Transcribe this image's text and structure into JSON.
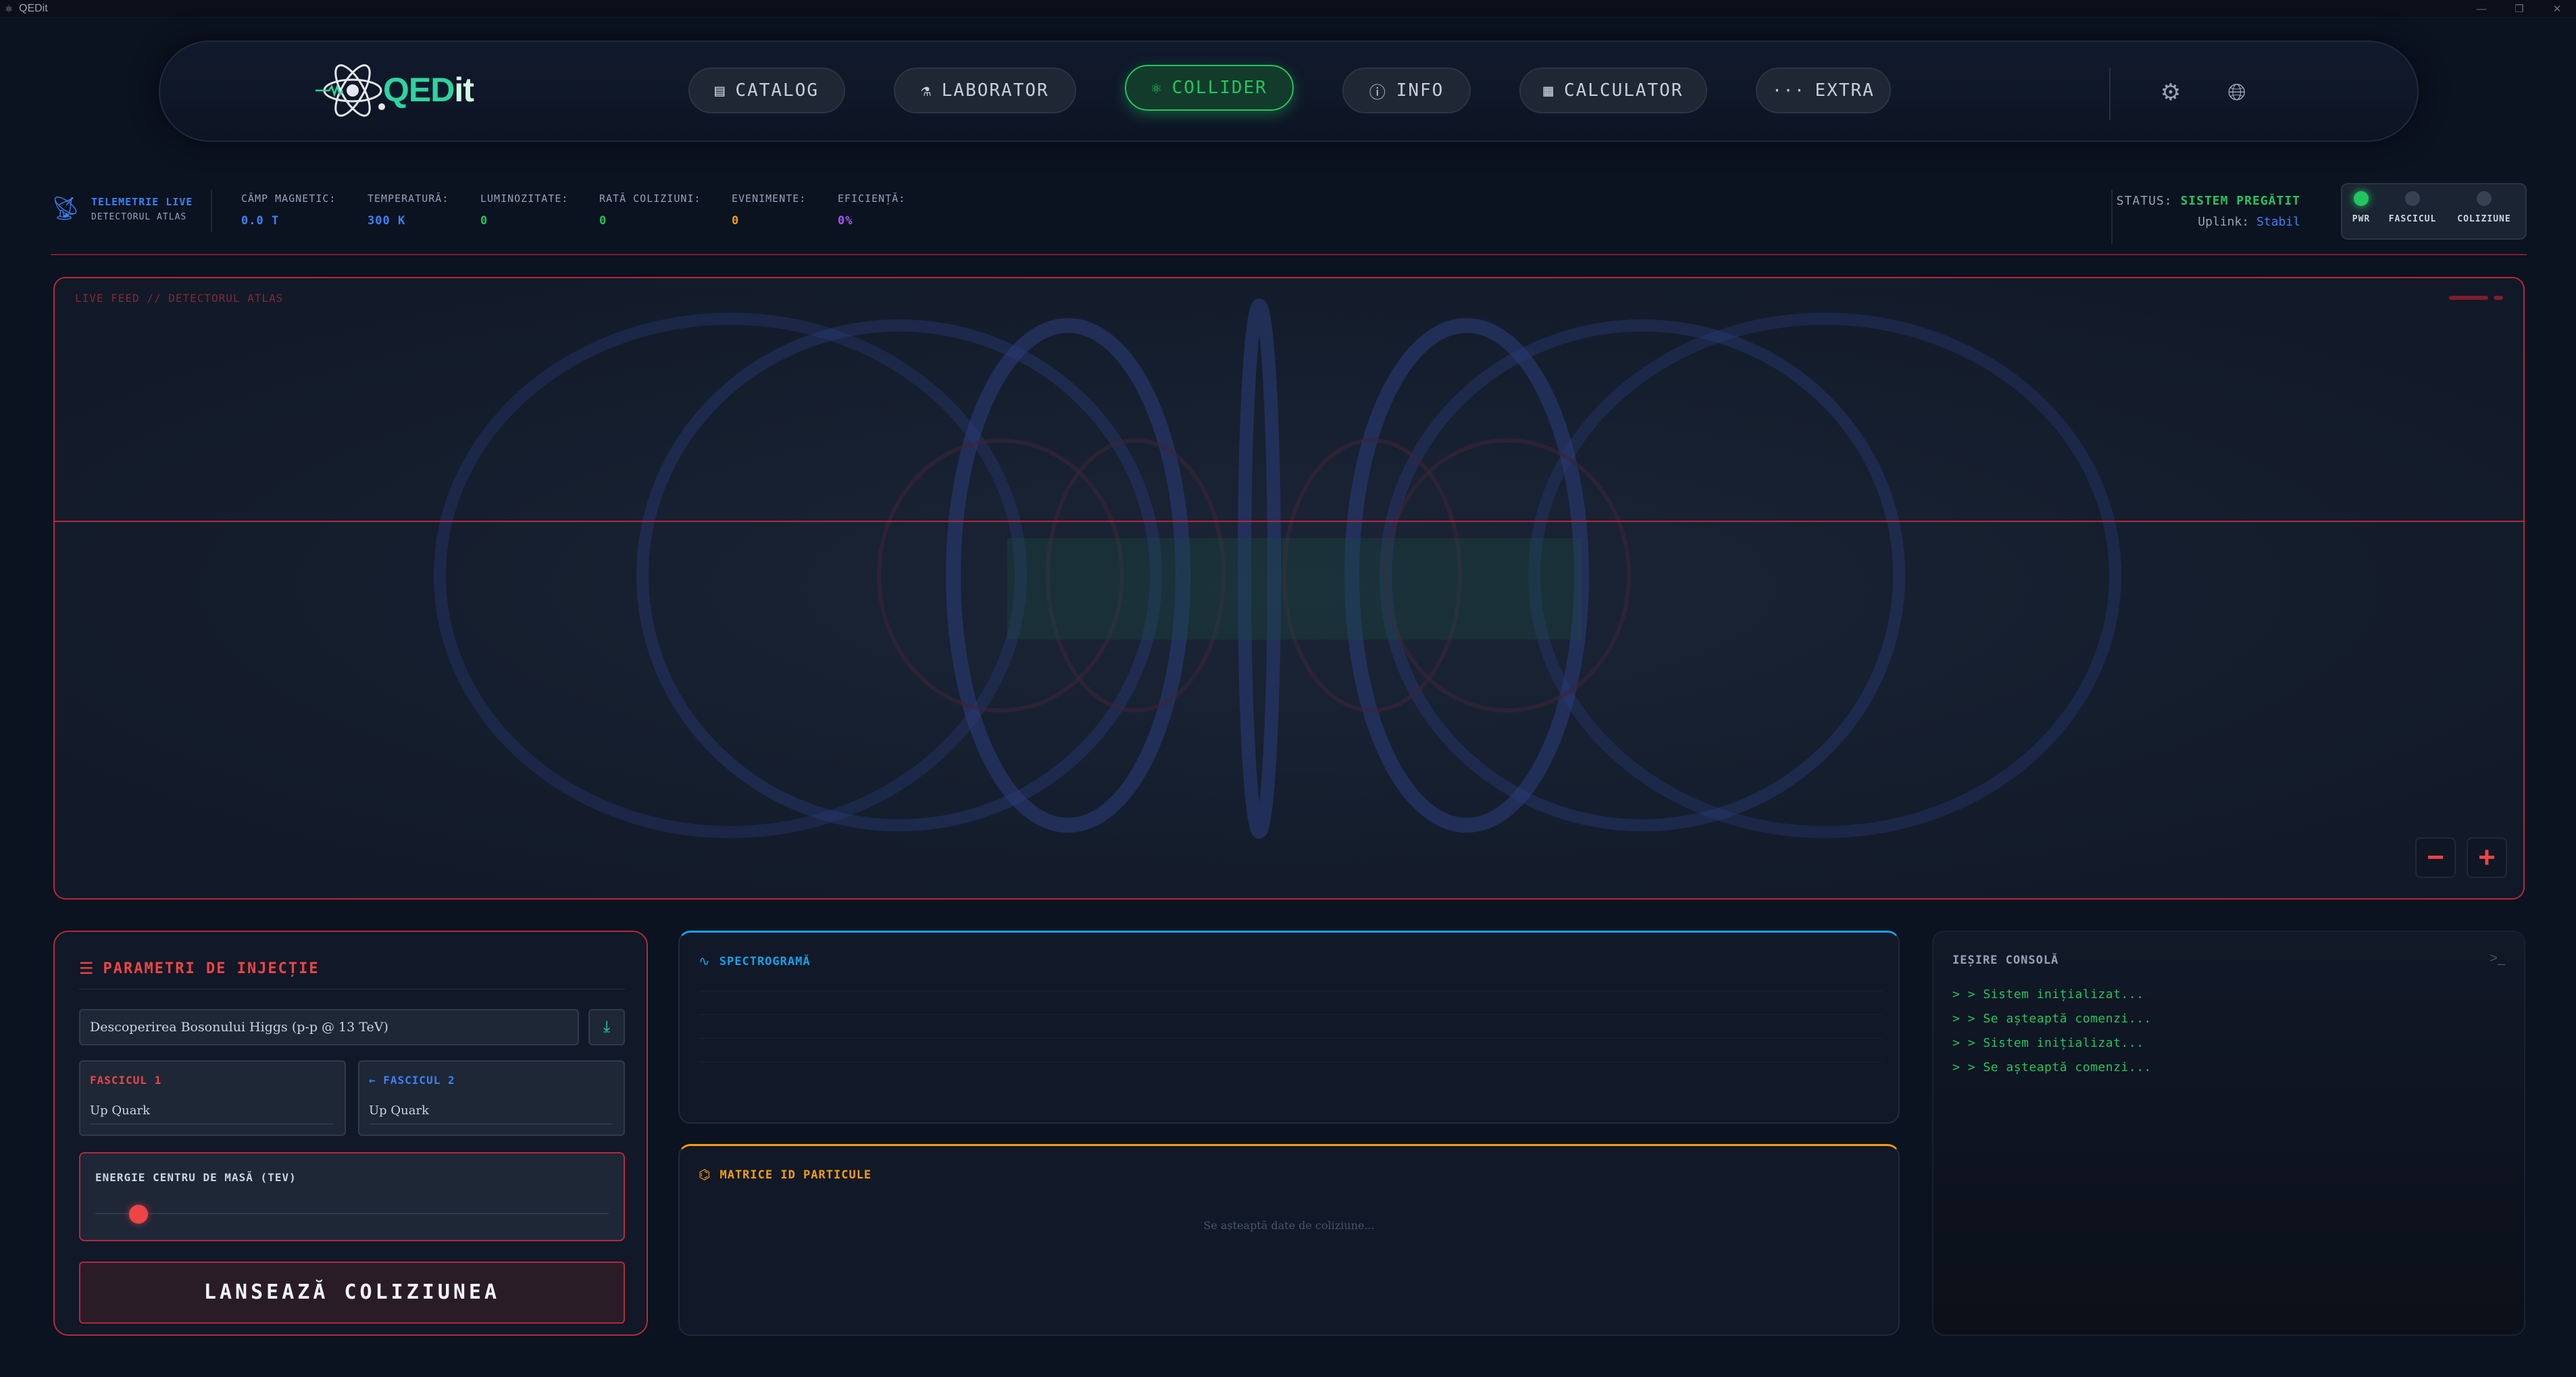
{
  "window": {
    "title": "QEDit",
    "controls": [
      "—",
      "❐",
      "✕"
    ]
  },
  "brand": {
    "name_main": "QED",
    "name_suffix": "it"
  },
  "nav": {
    "items": [
      {
        "label": "CATALOG",
        "icon": "book-icon"
      },
      {
        "label": "LABORATOR",
        "icon": "microscope-icon"
      },
      {
        "label": "COLLIDER",
        "icon": "atom-icon",
        "active": true
      },
      {
        "label": "INFO",
        "icon": "info-icon"
      },
      {
        "label": "CALCULATOR",
        "icon": "calculator-icon"
      },
      {
        "label": "EXTRA",
        "icon": "dots-icon"
      }
    ],
    "settings_icon": "gear-icon",
    "language_icon": "globe-icon"
  },
  "telemetry": {
    "title": "TELEMETRIE LIVE",
    "subtitle": "DETECTORUL ATLAS",
    "metrics": [
      {
        "label": "CÂMP MAGNETIC:",
        "value": "0.0 T",
        "color": "#3b82f6"
      },
      {
        "label": "TEMPERATURĂ:",
        "value": "300 K",
        "color": "#3b82f6"
      },
      {
        "label": "LUMINOZITATE:",
        "value": "0",
        "color": "#22c55e"
      },
      {
        "label": "RATĂ COLIZIUNI:",
        "value": "0",
        "color": "#22c55e"
      },
      {
        "label": "EVENIMENTE:",
        "value": "0",
        "color": "#f59e0b"
      },
      {
        "label": "EFICIENȚĂ:",
        "value": "0%",
        "color": "#a855f7"
      }
    ],
    "status_label": "STATUS:",
    "status_value": "SISTEM PREGĂTIT",
    "uplink_label": "Uplink:",
    "uplink_value": "Stabil",
    "leds": [
      {
        "label": "PWR",
        "on": true
      },
      {
        "label": "FASCICUL",
        "on": false
      },
      {
        "label": "COLIZIUNE",
        "on": false
      }
    ]
  },
  "feed": {
    "label": "LIVE FEED // DETECTORUL ATLAS",
    "zoom_out": "−",
    "zoom_in": "+"
  },
  "params": {
    "title": "PARAMETRI DE INJECȚIE",
    "preset": "Descoperirea Bosonului Higgs (p-p @ 13 TeV)",
    "beam1_label": "FASCICUL 1",
    "beam1_value": "Up Quark",
    "beam2_label": "FASCICUL 2",
    "beam2_value": "Up Quark",
    "energy_label": "ENERGIE CENTRU DE MASĂ (TEV)",
    "launch_label": "LANSEAZĂ COLIZIUNEA"
  },
  "spectrogram": {
    "title": "SPECTROGRAMĂ"
  },
  "matrix": {
    "title": "MATRICE ID PARTICULE",
    "waiting": "Se așteaptă date de coliziune..."
  },
  "console": {
    "title": "IEȘIRE CONSOLĂ",
    "lines": [
      "> > Sistem inițializat...",
      "> > Se așteaptă comenzi...",
      "> > Sistem inițializat...",
      "> > Se așteaptă comenzi..."
    ]
  },
  "colors": {
    "accent_green": "#22c55e",
    "accent_red": "#ef4444",
    "accent_blue": "#3b82f6",
    "accent_amber": "#f59e0b"
  }
}
